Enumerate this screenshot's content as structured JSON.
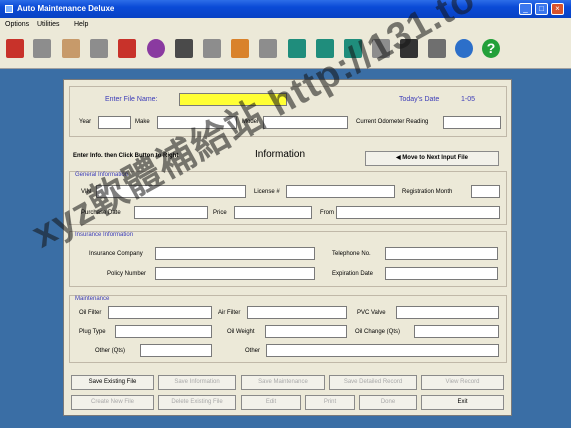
{
  "window": {
    "title": "Auto Maintenance Deluxe"
  },
  "menu": [
    "Options",
    "Utilities",
    "Help"
  ],
  "toolbar_icons": [
    "red-book-icon",
    "gray-car-icon",
    "wrench-icon",
    "tools-icon",
    "globe-shine-icon",
    "calculator-icon",
    "printer-icon",
    "house-icon",
    "notepad-icon",
    "teal-book-1-icon",
    "teal-book-2-icon",
    "teal-book-3-icon",
    "key-icon",
    "lock-icon",
    "padlock-icon",
    "globe-icon",
    "help-icon"
  ],
  "header": {
    "file_label": "Enter File Name:",
    "file_value": "",
    "today_label": "Today's Date",
    "today_value": "1-05",
    "year_label": "Year",
    "make_label": "Make",
    "model_label": "Model",
    "odometer_label": "Current Odometer Reading"
  },
  "info_bar": {
    "instruction": "Enter Info. then Click Button to Right",
    "title": "Information",
    "move_button": "Move to Next Input File"
  },
  "general": {
    "title": "General Information",
    "vin": "VIN",
    "license": "License #",
    "registration": "Registration Month",
    "purchase_date": "Purchase Date",
    "price": "Price",
    "from": "From"
  },
  "insurance": {
    "title": "Insurance Information",
    "company": "Insurance Company",
    "telephone": "Telephone No.",
    "policy": "Policy Number",
    "expiration": "Expiration Date"
  },
  "maintenance": {
    "title": "Maintenance",
    "oil_filter": "Oil Filter",
    "air_filter": "Air Filter",
    "pvc_valve": "PVC Valve",
    "plugs": "Plug Type",
    "oil_weight": "Oil Weight",
    "oil_change": "Oil Change (Qts)",
    "other_qts": "Other (Qts)",
    "other": "Other"
  },
  "buttons": {
    "row1": [
      "Save Existing File",
      "Save Information",
      "Save Maintenance",
      "Save Detailed Record",
      "View Record"
    ],
    "row2": [
      "Create New File",
      "Delete Existing File",
      "Edit",
      "Print",
      "Done",
      "Exit"
    ]
  },
  "watermark": "xyz軟體補給站 http://131.to"
}
